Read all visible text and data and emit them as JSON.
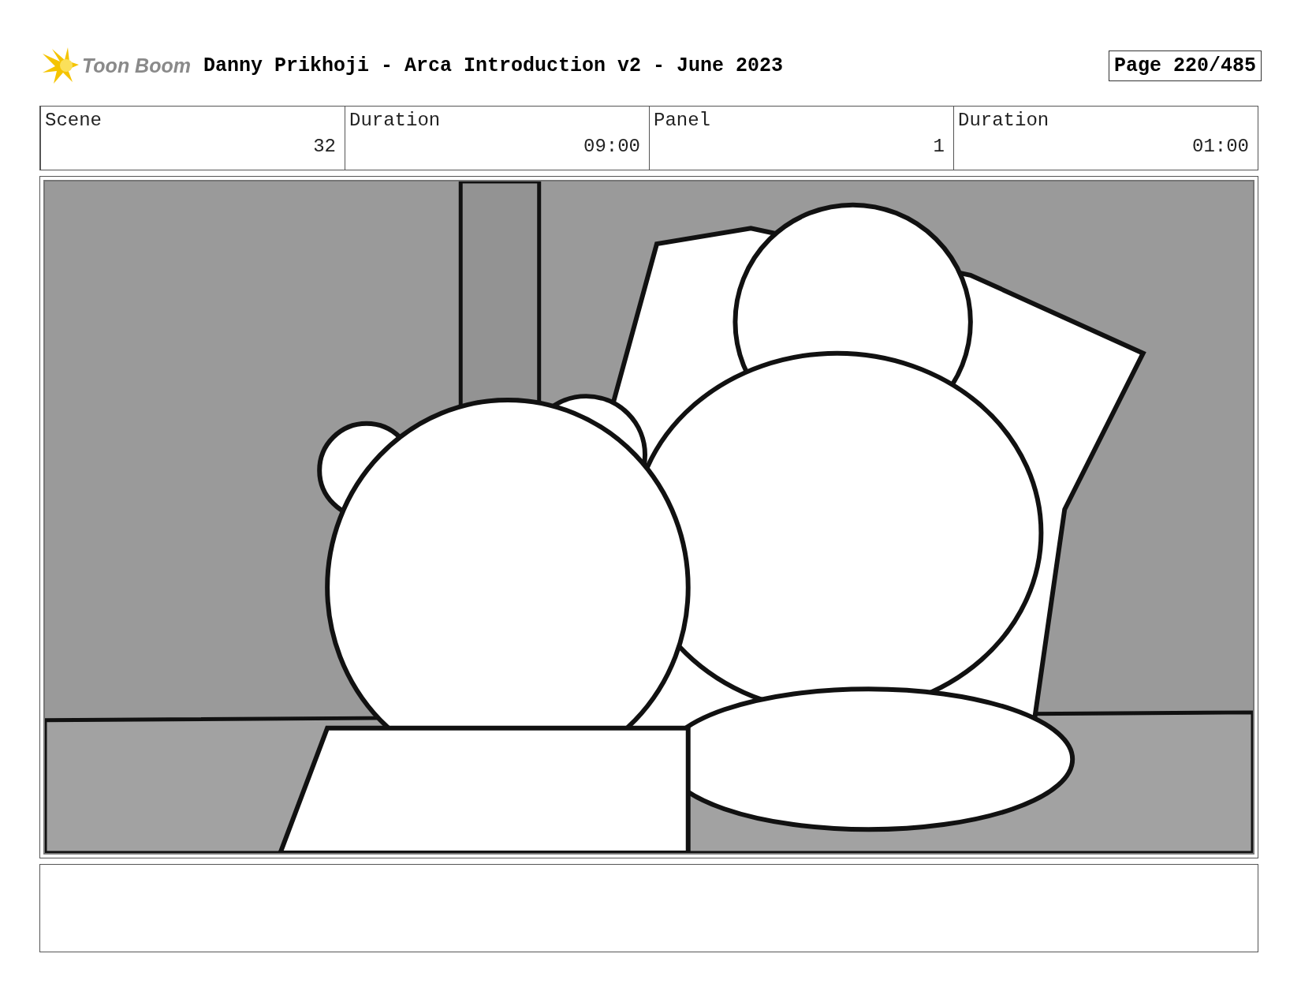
{
  "header": {
    "logo_text": "Toon Boom",
    "title": "Danny Prikhoji - Arca Introduction v2 - June 2023",
    "page": "Page 220/485"
  },
  "info": {
    "columns": [
      "Scene",
      "Duration",
      "Panel",
      "Duration"
    ],
    "values": [
      "32",
      "09:00",
      "1",
      "01:00"
    ]
  }
}
